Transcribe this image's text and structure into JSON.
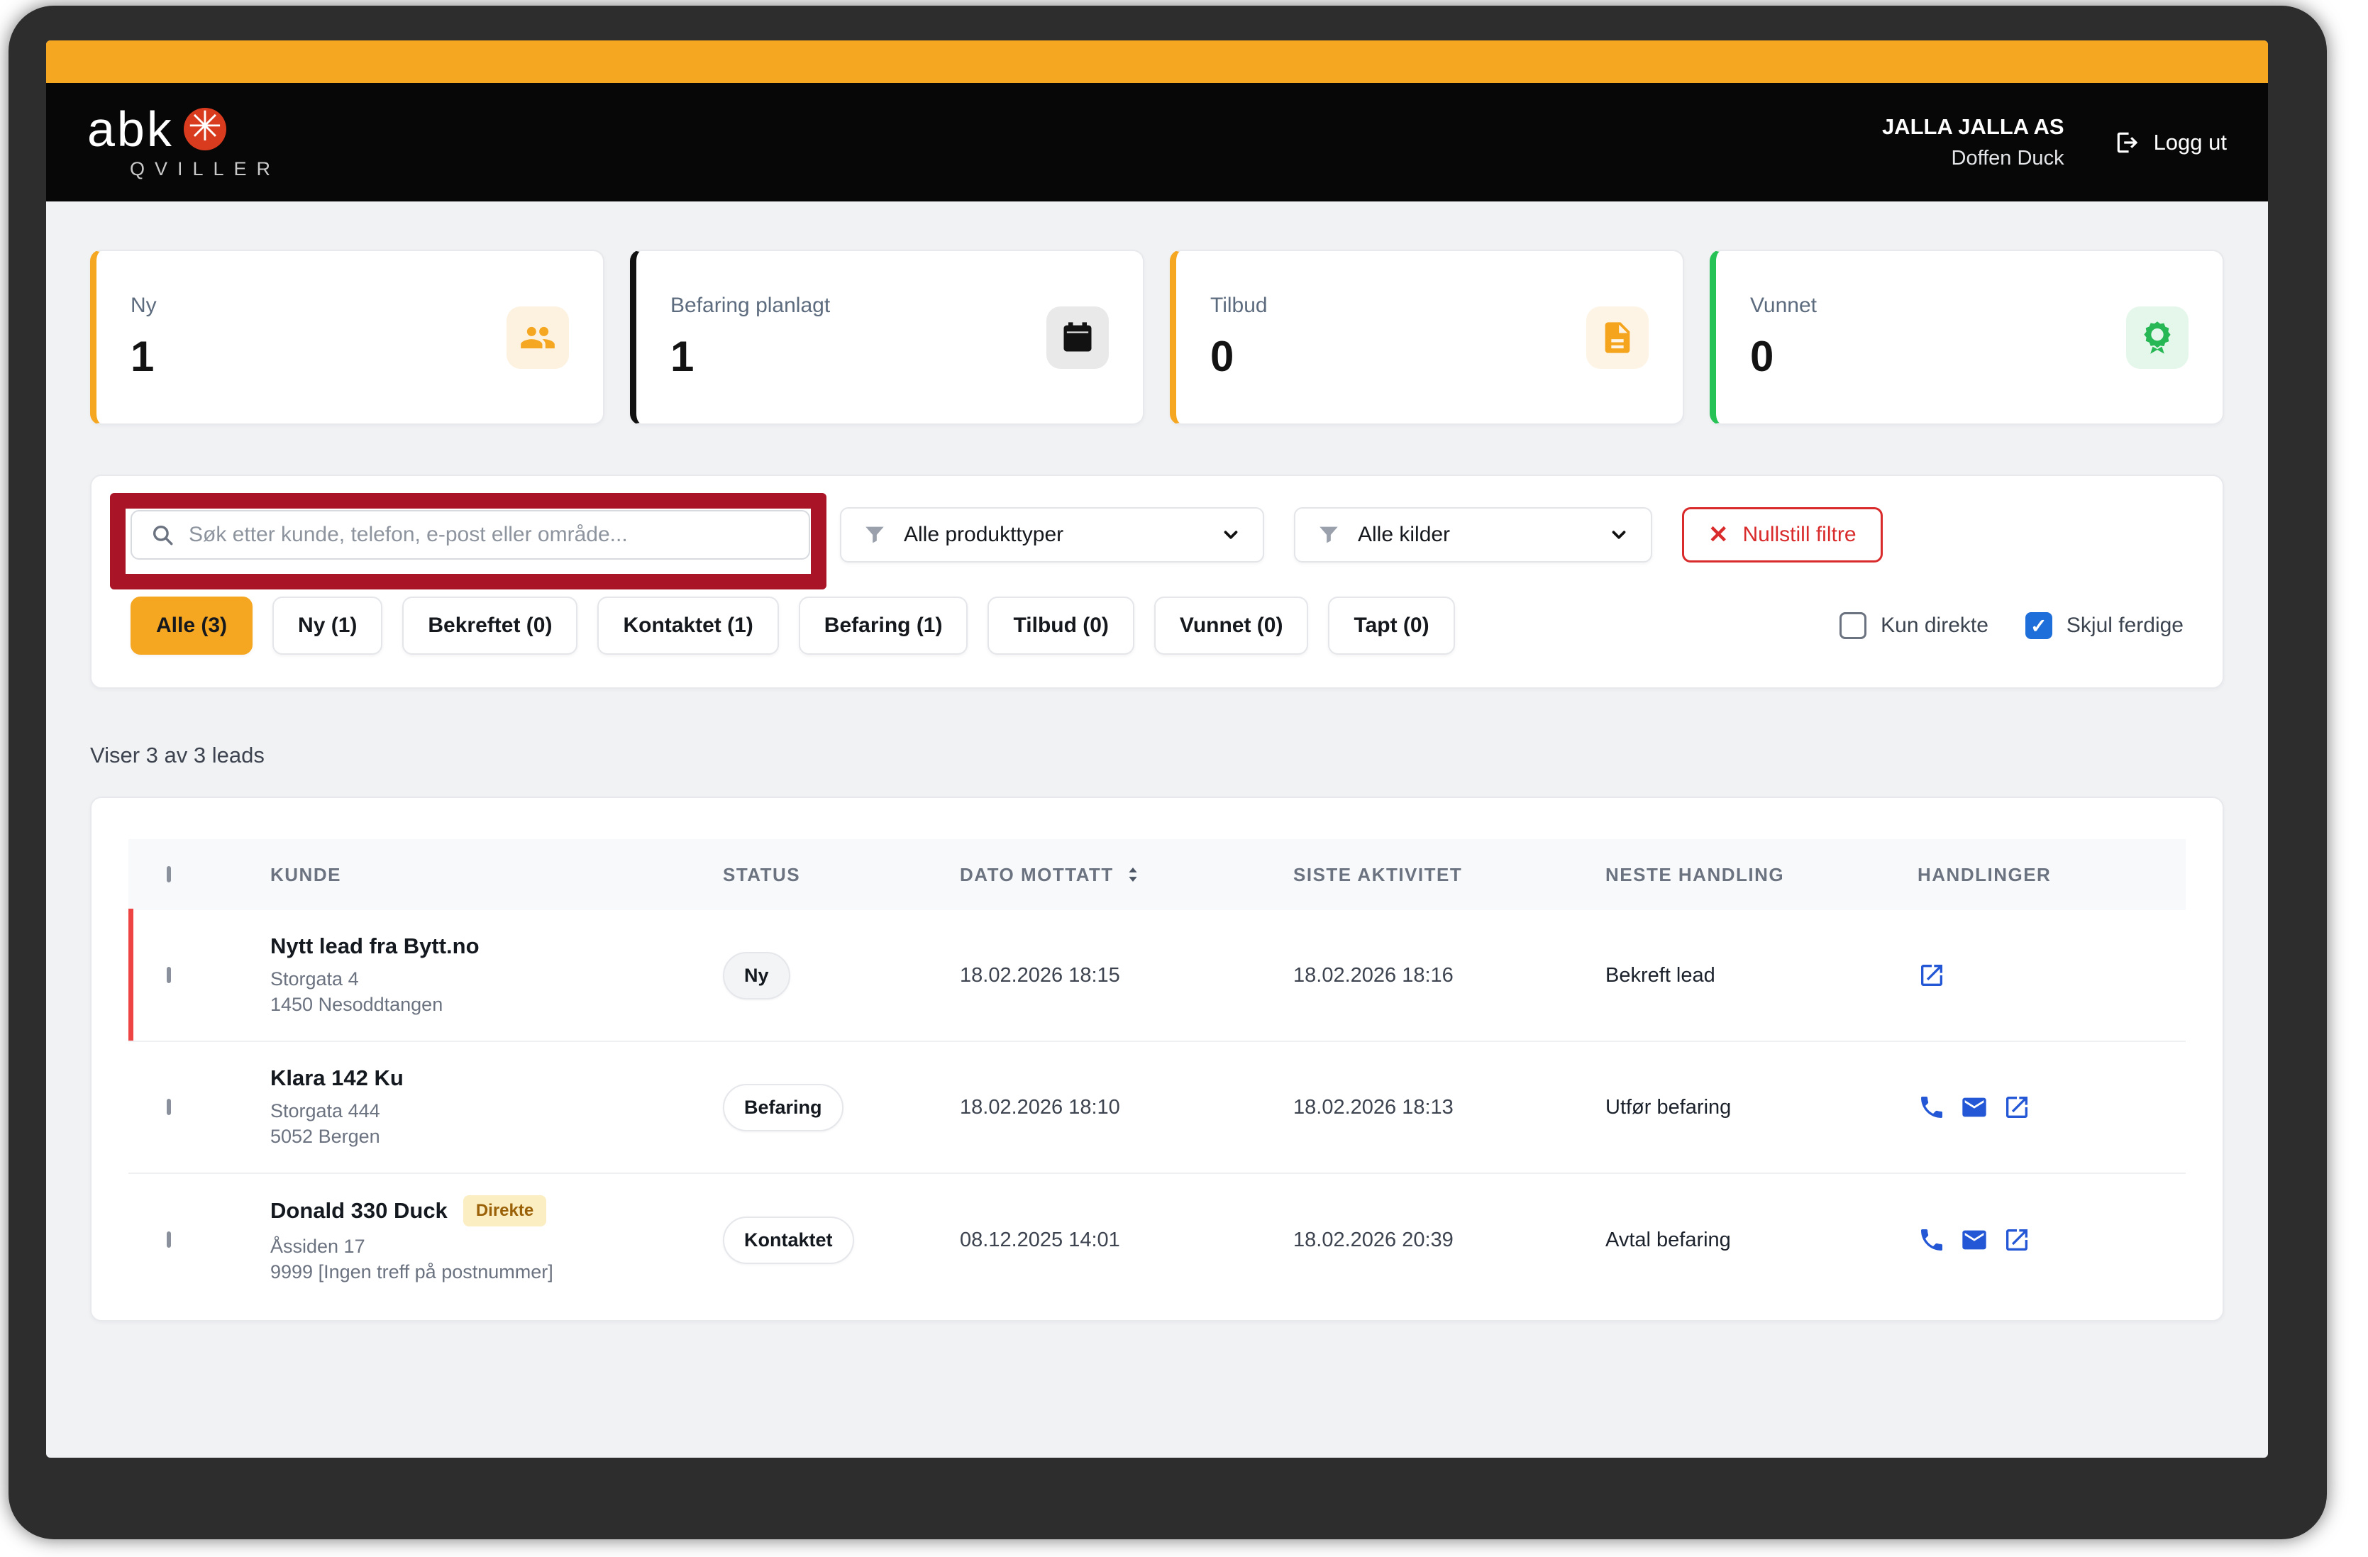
{
  "header": {
    "brand_name": "abk",
    "brand_sub": "QVILLER",
    "company": "JALLA JALLA AS",
    "user": "Doffen Duck",
    "logout_label": "Logg ut"
  },
  "stats": [
    {
      "label": "Ny",
      "value": "1",
      "accent": "#F6A722",
      "icon": "users-icon",
      "icon_bg": "#FDF1DF"
    },
    {
      "label": "Befaring planlagt",
      "value": "1",
      "accent": "#111111",
      "icon": "calendar-icon",
      "icon_bg": "#E9E9EA"
    },
    {
      "label": "Tilbud",
      "value": "0",
      "accent": "#F6A722",
      "icon": "document-icon",
      "icon_bg": "#FDF4E6"
    },
    {
      "label": "Vunnet",
      "value": "0",
      "accent": "#27C256",
      "icon": "award-icon",
      "icon_bg": "#E4F7EA"
    }
  ],
  "filters": {
    "search_placeholder": "Søk etter kunde, telefon, e-post eller område...",
    "product_filter_value": "Alle produkttyper",
    "source_filter_value": "Alle kilder",
    "reset_label": "Nullstill filtre",
    "active_tab_index": 0,
    "tabs": [
      {
        "label": "Alle (3)"
      },
      {
        "label": "Ny (1)"
      },
      {
        "label": "Bekreftet (0)"
      },
      {
        "label": "Kontaktet (1)"
      },
      {
        "label": "Befaring (1)"
      },
      {
        "label": "Tilbud (0)"
      },
      {
        "label": "Vunnet (0)"
      },
      {
        "label": "Tapt (0)"
      }
    ],
    "checkboxes": [
      {
        "label": "Kun direkte",
        "checked": false
      },
      {
        "label": "Skjul ferdige",
        "checked": true
      }
    ]
  },
  "summary": "Viser 3 av 3 leads",
  "table": {
    "columns": [
      "KUNDE",
      "STATUS",
      "DATO MOTTATT",
      "SISTE AKTIVITET",
      "NESTE HANDLING",
      "HANDLINGER"
    ],
    "rows": [
      {
        "name": "Nytt lead fra Bytt.no",
        "badge": "",
        "address1": "Storgata 4",
        "address2": "1450 Nesoddtangen",
        "status": "Ny",
        "received": "18.02.2026 18:15",
        "last_activity": "18.02.2026 18:16",
        "next_action": "Bekreft lead",
        "actions": [
          "open"
        ],
        "highlighted": true
      },
      {
        "name": "Klara 142 Ku",
        "badge": "",
        "address1": "Storgata 444",
        "address2": "5052 Bergen",
        "status": "Befaring",
        "received": "18.02.2026 18:10",
        "last_activity": "18.02.2026 18:13",
        "next_action": "Utfør befaring",
        "actions": [
          "phone",
          "email",
          "open"
        ],
        "highlighted": false
      },
      {
        "name": "Donald 330 Duck",
        "badge": "Direkte",
        "address1": "Åssiden 17",
        "address2": "9999 [Ingen treff på postnummer]",
        "status": "Kontaktet",
        "received": "08.12.2025 14:01",
        "last_activity": "18.02.2026 20:39",
        "next_action": "Avtal befaring",
        "actions": [
          "phone",
          "email",
          "open"
        ],
        "highlighted": false
      }
    ]
  },
  "colors": {
    "top_bar_orange": "#F6A722",
    "annotation_red": "#A91426",
    "action_blue": "#2357D5",
    "row_highlight_red": "#EF4444",
    "checkbox_checked_blue": "#1E6FD9",
    "won_green": "#27C256"
  }
}
